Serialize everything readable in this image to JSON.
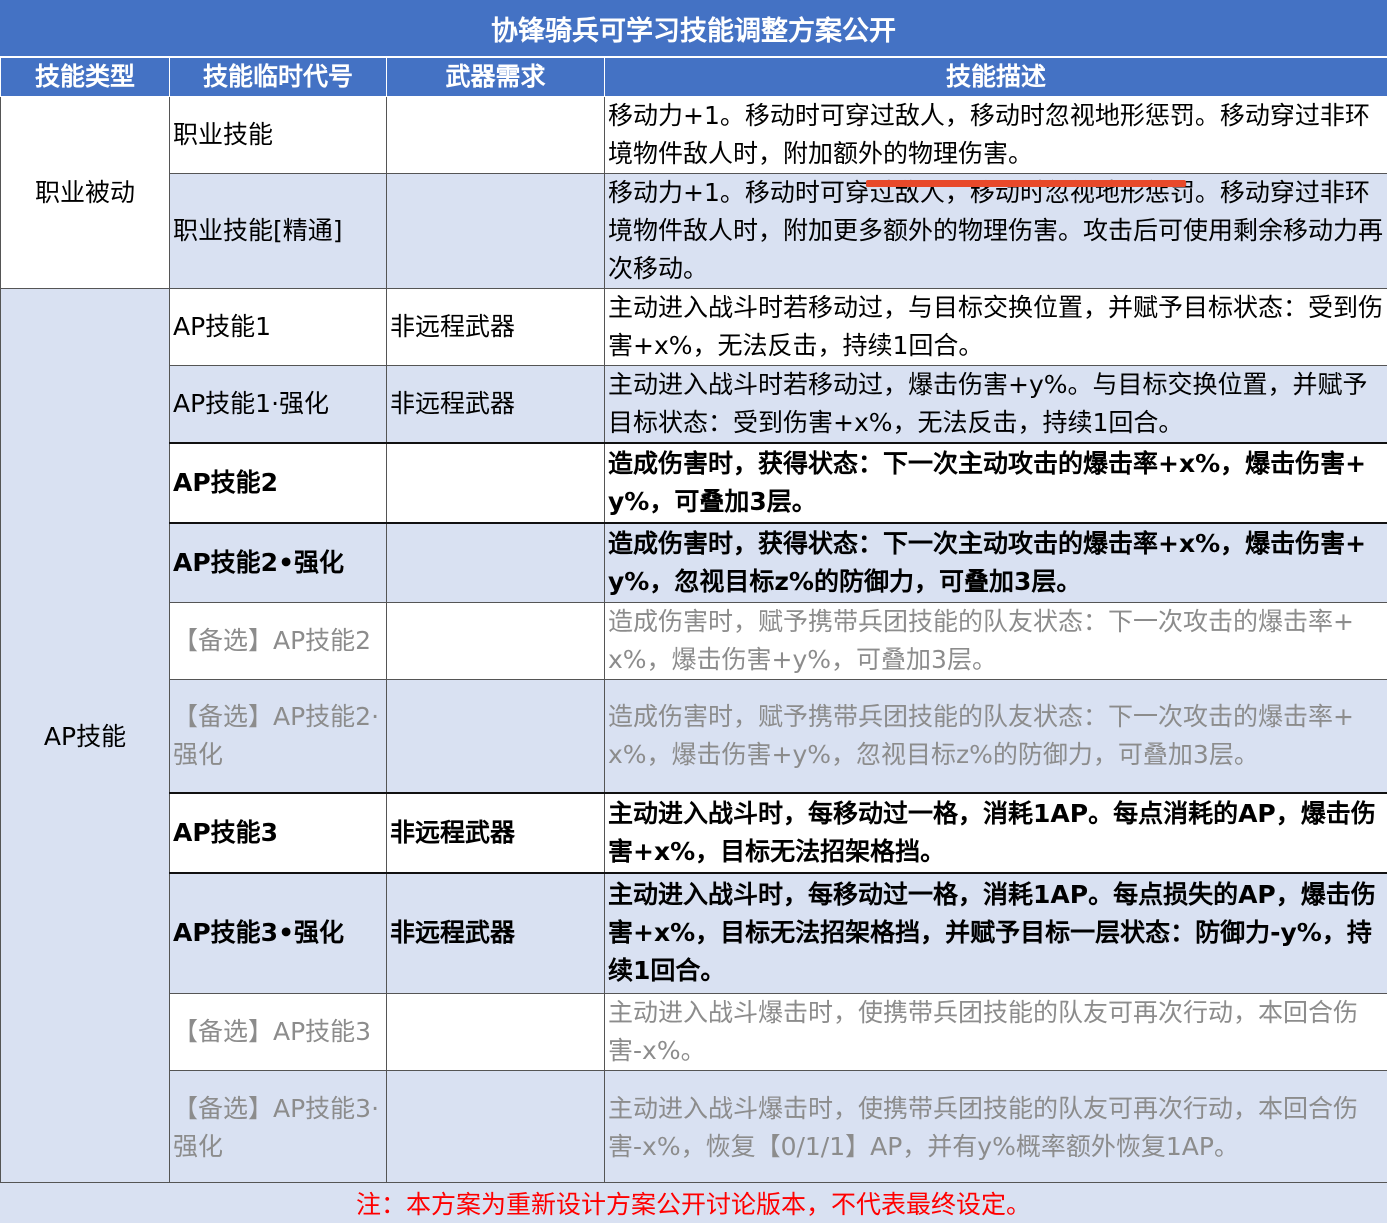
{
  "title": "协锋骑兵可学习技能调整方案公开",
  "headers": [
    "技能类型",
    "技能临时代号",
    "武器需求",
    "技能描述"
  ],
  "groups": [
    {
      "type": "职业被动",
      "rows": [
        {
          "code": "职业技能",
          "weapon": "",
          "desc": "移动力+1。移动时可穿过敌人，移动时忽视地形惩罚。移动穿过非环境物件敌人时，附加额外的物理伤害。"
        },
        {
          "code": "职业技能[精通]",
          "weapon": "",
          "desc": "移动力+1。移动时可穿过敌人，移动时忽视地形惩罚。移动穿过非环境物件敌人时，附加更多额外的物理伤害。攻击后可使用剩余移动力再次移动。"
        }
      ]
    },
    {
      "type": "AP技能",
      "rows": [
        {
          "code": "AP技能1",
          "weapon": "非远程武器",
          "desc": "主动进入战斗时若移动过，与目标交换位置，并赋予目标状态：受到伤害+x%，无法反击，持续1回合。"
        },
        {
          "code": "AP技能1·强化",
          "weapon": "非远程武器",
          "desc": "主动进入战斗时若移动过，爆击伤害+y%。与目标交换位置，并赋予目标状态：受到伤害+x%，无法反击，持续1回合。"
        },
        {
          "code": "AP技能2",
          "weapon": "",
          "desc": "造成伤害时，获得状态：下一次主动攻击的爆击率+x%，爆击伤害+y%，可叠加3层。"
        },
        {
          "code": "AP技能2•强化",
          "weapon": "",
          "desc": "造成伤害时，获得状态：下一次主动攻击的爆击率+x%，爆击伤害+y%，忽视目标z%的防御力，可叠加3层。"
        },
        {
          "code": "【备选】AP技能2",
          "weapon": "",
          "desc": "造成伤害时，赋予携带兵团技能的队友状态：下一次攻击的爆击率+x%，爆击伤害+y%，可叠加3层。"
        },
        {
          "code": "【备选】AP技能2·强化",
          "weapon": "",
          "desc": "造成伤害时，赋予携带兵团技能的队友状态：下一次攻击的爆击率+x%，爆击伤害+y%，忽视目标z%的防御力，可叠加3层。"
        },
        {
          "code": "AP技能3",
          "weapon": "非远程武器",
          "desc": "主动进入战斗时，每移动过一格，消耗1AP。每点消耗的AP，爆击伤害+x%，目标无法招架格挡。"
        },
        {
          "code": "AP技能3•强化",
          "weapon": "非远程武器",
          "desc": "主动进入战斗时，每移动过一格，消耗1AP。每点损失的AP，爆击伤害+x%，目标无法招架格挡，并赋予目标一层状态：防御力-y%，持续1回合。"
        },
        {
          "code": "【备选】AP技能3",
          "weapon": "",
          "desc": "主动进入战斗爆击时，使携带兵团技能的队友可再次行动，本回合伤害-x%。"
        },
        {
          "code": "【备选】AP技能3·强化",
          "weapon": "",
          "desc": "主动进入战斗爆击时，使携带兵团技能的队友可再次行动，本回合伤害-x%，恢复【0/1/1】AP，并有y%概率额外恢复1AP。"
        }
      ]
    }
  ],
  "footnote": "注：本方案为重新设计方案公开讨论版本，不代表最终设定。",
  "colors": {
    "header_bg": "#4472c4",
    "alt_row_bg": "#d9e1f2",
    "footnote_text": "#ff0000",
    "annotation_line": "#e8492a",
    "optional_text": "#8c8c8c"
  }
}
